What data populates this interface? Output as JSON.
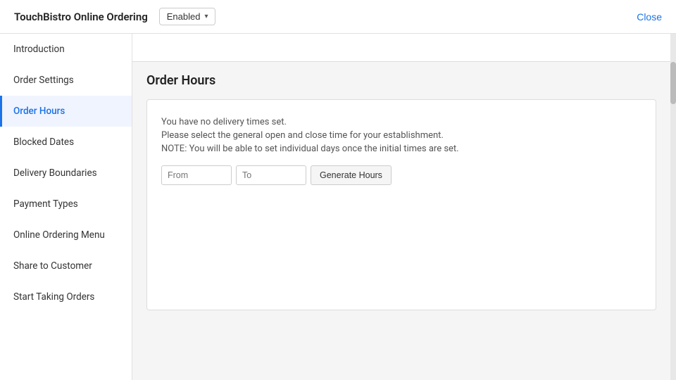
{
  "header": {
    "title": "TouchBistro Online Ordering",
    "status": "Enabled",
    "close_label": "Close"
  },
  "sidebar": {
    "items": [
      {
        "id": "introduction",
        "label": "Introduction",
        "active": false
      },
      {
        "id": "order-settings",
        "label": "Order Settings",
        "active": false
      },
      {
        "id": "order-hours",
        "label": "Order Hours",
        "active": true
      },
      {
        "id": "blocked-dates",
        "label": "Blocked Dates",
        "active": false
      },
      {
        "id": "delivery-boundaries",
        "label": "Delivery Boundaries",
        "active": false
      },
      {
        "id": "payment-types",
        "label": "Payment Types",
        "active": false
      },
      {
        "id": "online-ordering-menu",
        "label": "Online Ordering Menu",
        "active": false
      },
      {
        "id": "share-to-customer",
        "label": "Share to Customer",
        "active": false
      },
      {
        "id": "start-taking-orders",
        "label": "Start Taking Orders",
        "active": false
      }
    ]
  },
  "main": {
    "page_title": "Order Hours",
    "no_delivery_line1": "You have no delivery times set.",
    "no_delivery_line2": "Please select the general open and close time for your establishment.",
    "no_delivery_line3": "NOTE: You will be able to set individual days once the initial times are set.",
    "from_placeholder": "From",
    "to_placeholder": "To",
    "generate_btn_label": "Generate Hours"
  }
}
